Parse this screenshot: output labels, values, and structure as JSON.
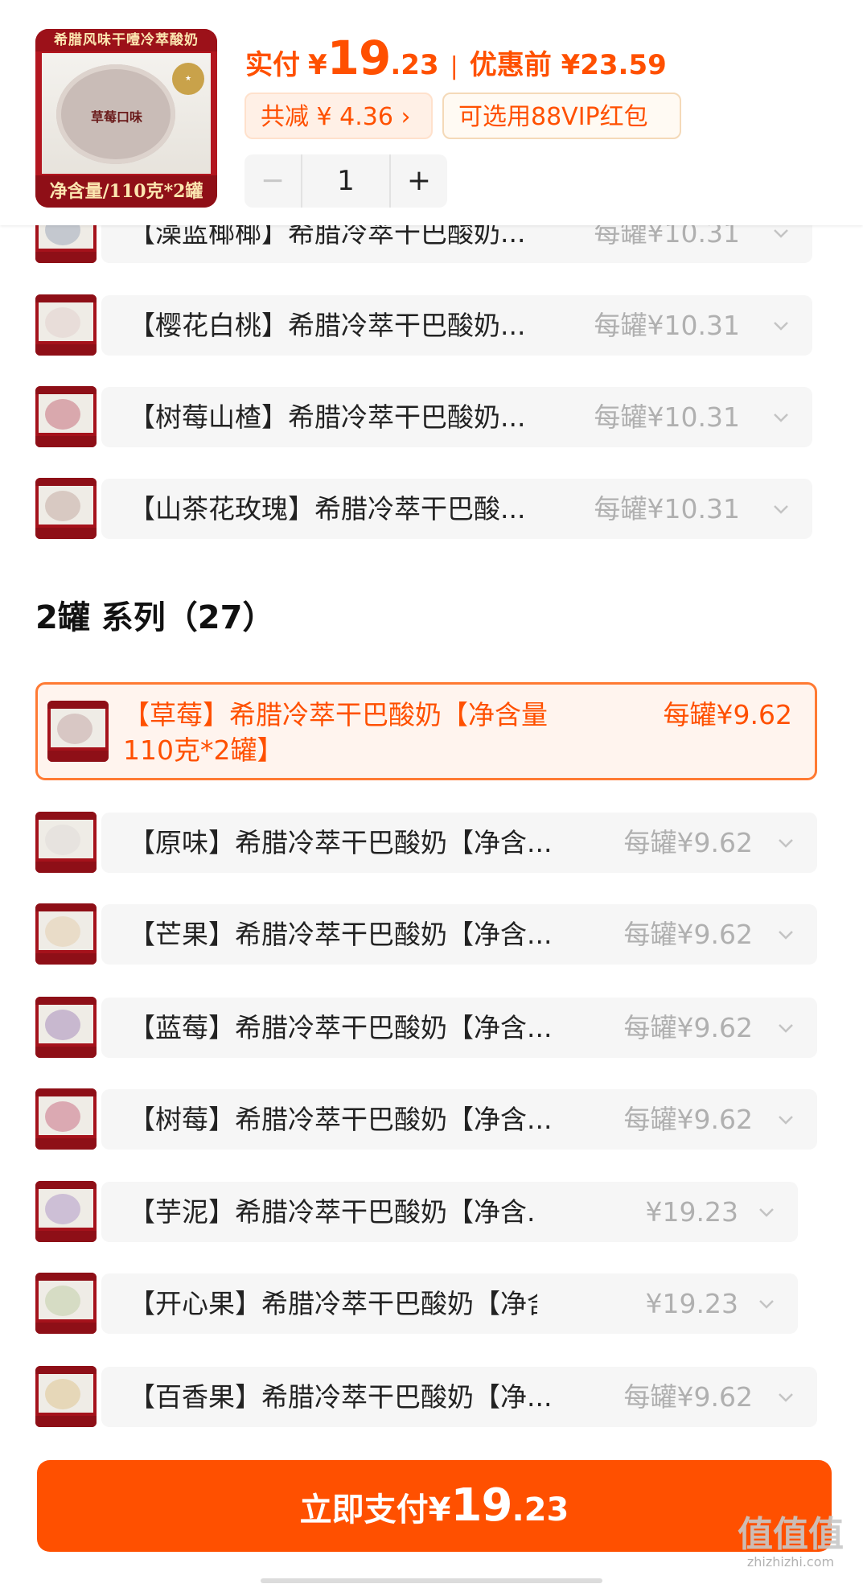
{
  "header": {
    "product_image_banner": "希腊风味干噎冷萃酸奶",
    "product_image_center": "草莓口味",
    "product_image_net": "净含量/110克*2罐",
    "price_label": "实付",
    "currency": "¥",
    "price_int": "19",
    "price_dec": ".23",
    "separator": "|",
    "pre_discount_label": "优惠前 ¥23.59",
    "save_label": "共减 ¥ 4.36 ›",
    "vip_label": "可选用88VIP红包",
    "qty_minus": "−",
    "qty_value": "1",
    "qty_plus": "+"
  },
  "rows_top": [
    {
      "name": "【澡蓝椰椰】希腊冷萃干巴酸奶...",
      "price": "每罐¥10.31",
      "disc": "#c4c8cf"
    },
    {
      "name": "【樱花白桃】希腊冷萃干巴酸奶...",
      "price": "每罐¥10.31",
      "disc": "#e8ddd9"
    },
    {
      "name": "【树莓山楂】希腊冷萃干巴酸奶...",
      "price": "每罐¥10.31",
      "disc": "#d9a8ad"
    },
    {
      "name": "【山茶花玫瑰】希腊冷萃干巴酸...",
      "price": "每罐¥10.31",
      "disc": "#d8c9c2"
    }
  ],
  "section_title": "2罐 系列（27）",
  "selected": {
    "name": "【草莓】希腊冷萃干巴酸奶【净含量110克*2罐】",
    "price": "每罐¥9.62"
  },
  "rows_bottom": [
    {
      "name": "【原味】希腊冷萃干巴酸奶【净含...",
      "price": "每罐¥9.62",
      "disc": "#e7e3df"
    },
    {
      "name": "【芒果】希腊冷萃干巴酸奶【净含...",
      "price": "每罐¥9.62",
      "disc": "#e9dcc8"
    },
    {
      "name": "【蓝莓】希腊冷萃干巴酸奶【净含...",
      "price": "每罐¥9.62",
      "disc": "#c8b8cf"
    },
    {
      "name": "【树莓】希腊冷萃干巴酸奶【净含...",
      "price": "每罐¥9.62",
      "disc": "#dba9b2"
    },
    {
      "name": "【芋泥】希腊冷萃干巴酸奶【净含...",
      "price": "¥19.23",
      "disc": "#cdbfd6"
    },
    {
      "name": "【开心果】希腊冷萃干巴酸奶【净含...",
      "price": "¥19.23",
      "disc": "#d6dcc4"
    },
    {
      "name": "【百香果】希腊冷萃干巴酸奶【净...",
      "price": "每罐¥9.62",
      "disc": "#e6d7b8"
    }
  ],
  "pay": {
    "label": "立即支付",
    "currency": "¥",
    "int": "19",
    "dec": ".23"
  },
  "watermark": {
    "line1": "值值值",
    "line2": "zhizhizhi.com"
  },
  "colors": {
    "accent": "#ff5000",
    "row_bg": "#f6f6f6",
    "muted": "#b0b0b0"
  }
}
